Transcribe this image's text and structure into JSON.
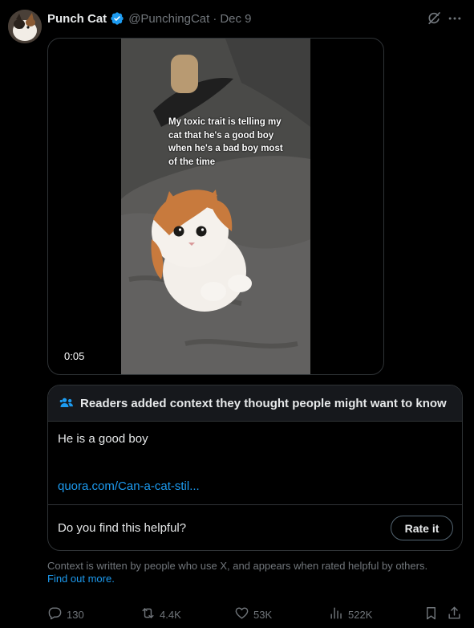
{
  "post": {
    "author_name": "Punch Cat",
    "handle": "@PunchingCat",
    "separator": "·",
    "date": "Dec 9",
    "video": {
      "caption": "My toxic trait is telling my cat that he's a good boy when he's a bad boy most of the time",
      "timestamp": "0:05"
    }
  },
  "community_note": {
    "title": "Readers added context they thought people might want to know",
    "body": "He is a good boy",
    "link": "quora.com/Can-a-cat-stil...",
    "helpful_question": "Do you find this helpful?",
    "rate_label": "Rate it",
    "footer_text": "Context is written by people who use X, and appears when rated helpful by others.",
    "footer_link": "Find out more."
  },
  "actions": {
    "replies": "130",
    "reposts": "4.4K",
    "likes": "53K",
    "views": "522K"
  },
  "colors": {
    "background": "#000000",
    "text": "#e7e9ea",
    "muted": "#71767b",
    "link": "#1d9bf0",
    "verified": "#1d9bf0",
    "border": "#2f3336"
  },
  "icons": [
    "verified-badge-icon",
    "grok-icon",
    "more-icon",
    "people-icon",
    "reply-icon",
    "repost-icon",
    "like-icon",
    "views-icon",
    "bookmark-icon",
    "share-icon"
  ]
}
